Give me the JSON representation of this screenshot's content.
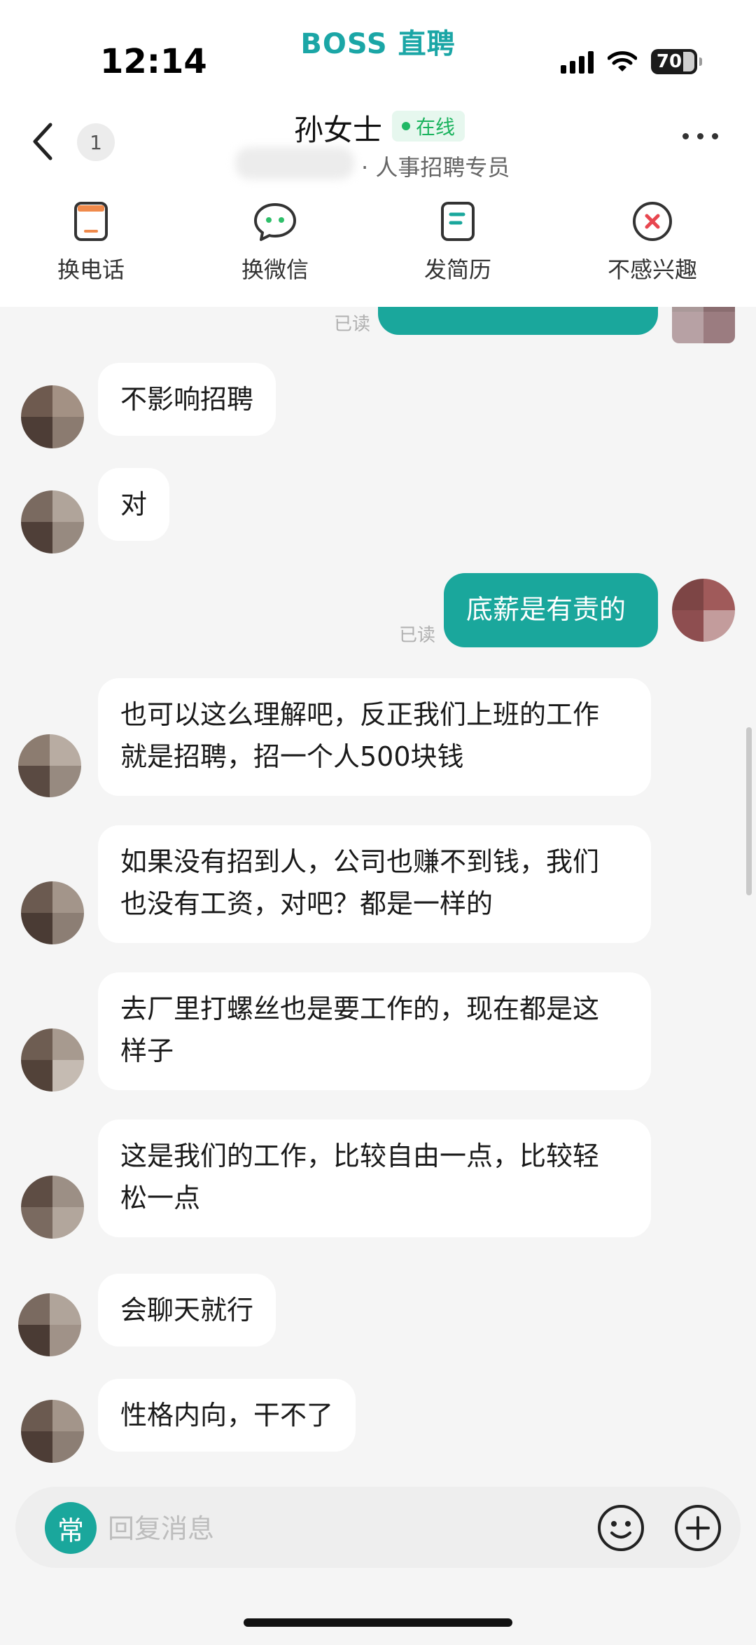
{
  "watermark": "BOSS 直聘",
  "status_bar": {
    "time": "12:14",
    "battery": "70"
  },
  "header": {
    "unread_count": "1",
    "contact_name": "孙女士",
    "online_status": "在线",
    "subtitle": "· 人事招聘专员"
  },
  "actions": [
    {
      "label": "换电话",
      "icon": "phone-card-icon"
    },
    {
      "label": "换微信",
      "icon": "wechat-icon"
    },
    {
      "label": "发简历",
      "icon": "resume-icon"
    },
    {
      "label": "不感兴趣",
      "icon": "not-interested-icon"
    }
  ],
  "messages": [
    {
      "from": "me",
      "text": "",
      "read": "已读"
    },
    {
      "from": "them",
      "text": "不影响招聘"
    },
    {
      "from": "them",
      "text": "对"
    },
    {
      "from": "me",
      "text": "底薪是有责的",
      "read": "已读"
    },
    {
      "from": "them",
      "lines": [
        "也可以这么理解吧，反正我们上班的工作",
        "就是招聘，招一个人500块钱"
      ]
    },
    {
      "from": "them",
      "lines": [
        "如果没有招到人，公司也赚不到钱，我们",
        "也没有工资，对吧？都是一样的"
      ]
    },
    {
      "from": "them",
      "lines": [
        "去厂里打螺丝也是要工作的，现在都是这",
        "样子"
      ]
    },
    {
      "from": "them",
      "lines": [
        "这是我们的工作，比较自由一点，比较轻",
        "松一点"
      ]
    },
    {
      "from": "them",
      "text": "会聊天就行"
    },
    {
      "from": "them",
      "text": "性格内向，干不了"
    }
  ],
  "input": {
    "common_phrases_label": "常",
    "placeholder": "回复消息"
  },
  "colors": {
    "brand_teal": "#1aa79c",
    "online_green": "#20b865",
    "reject_red": "#e8464f"
  }
}
